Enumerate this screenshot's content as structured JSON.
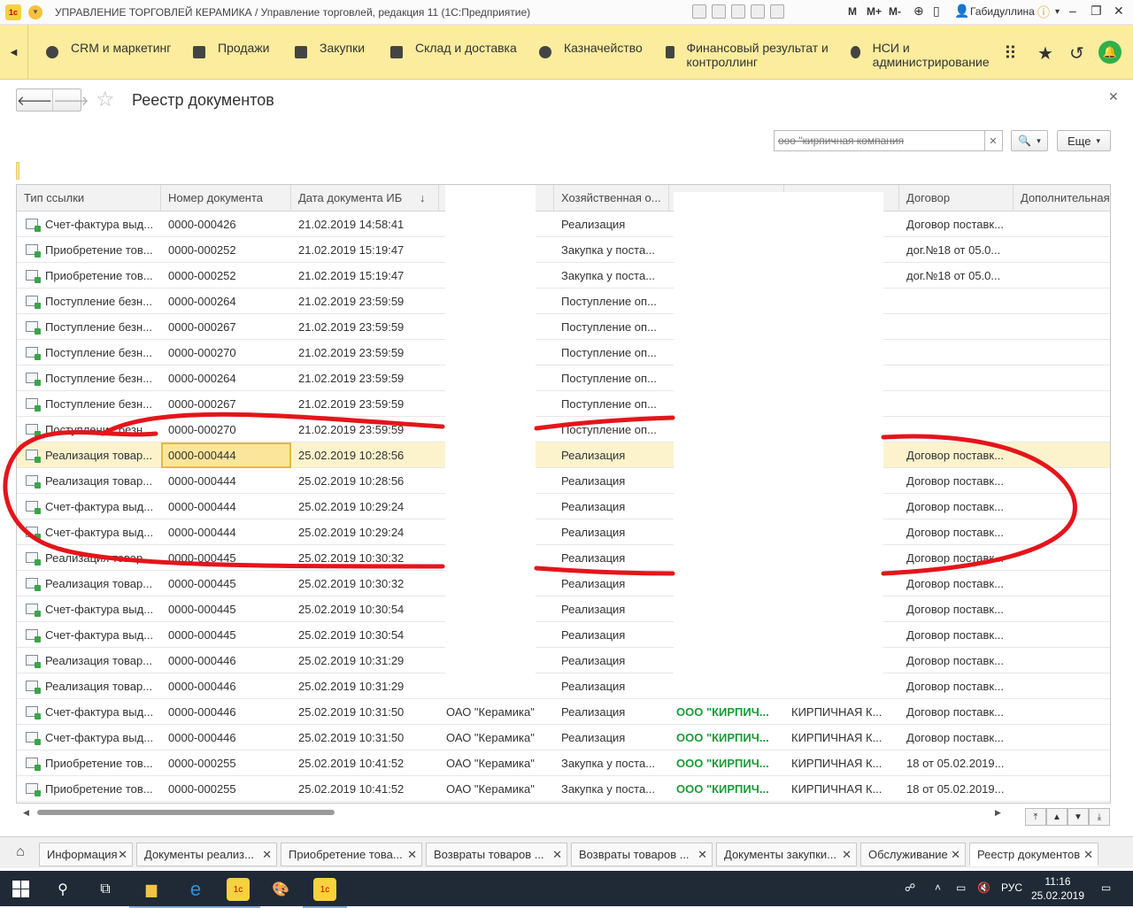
{
  "window": {
    "title": "УПРАВЛЕНИЕ ТОРГОВЛЕЙ КЕРАМИКА / Управление торговлей, редакция 11  (1С:Предприятие)",
    "m_labels": [
      "M",
      "M+",
      "M-"
    ],
    "user": "Габидуллина"
  },
  "menu": {
    "items": [
      {
        "label": "CRM и маркетинг",
        "icon": "pie-chart-icon"
      },
      {
        "label": "Продажи",
        "icon": "bag-icon"
      },
      {
        "label": "Закупки",
        "icon": "cart-icon"
      },
      {
        "label": "Склад и доставка",
        "icon": "warehouse-icon"
      },
      {
        "label": "Казначейство",
        "icon": "coin-icon"
      },
      {
        "label": "Финансовый результат и контроллинг",
        "icon": "bar-chart-icon"
      },
      {
        "label": "НСИ и администрирование",
        "icon": "gear-icon"
      }
    ]
  },
  "form": {
    "title": "Реестр документов",
    "search_value": "ооо \"кирпичная компания",
    "more_label": "Еще"
  },
  "table": {
    "columns": [
      "Тип ссылки",
      "Номер документа",
      "Дата документа ИБ",
      "",
      "Хозяйственная о...",
      "",
      "",
      "Договор",
      "Дополнительная"
    ],
    "sort_indicator": "↓",
    "rows": [
      {
        "type": "Счет-фактура выд...",
        "num": "0000-000426",
        "date": "21.02.2019 14:58:41",
        "org": "",
        "op": "Реализация",
        "partner": "",
        "counter": "",
        "contract": "Договор поставк..."
      },
      {
        "type": "Приобретение тов...",
        "num": "0000-000252",
        "date": "21.02.2019 15:19:47",
        "org": "",
        "op": "Закупка у поста...",
        "partner": "",
        "counter": "",
        "contract": "дог.№18 от 05.0..."
      },
      {
        "type": "Приобретение тов...",
        "num": "0000-000252",
        "date": "21.02.2019 15:19:47",
        "org": "",
        "op": "Закупка у поста...",
        "partner": "",
        "counter": "",
        "contract": "дог.№18 от 05.0..."
      },
      {
        "type": "Поступление безн...",
        "num": "0000-000264",
        "date": "21.02.2019 23:59:59",
        "org": "",
        "op": "Поступление оп...",
        "partner": "",
        "counter": "",
        "contract": ""
      },
      {
        "type": "Поступление безн...",
        "num": "0000-000267",
        "date": "21.02.2019 23:59:59",
        "org": "",
        "op": "Поступление оп...",
        "partner": "",
        "counter": "",
        "contract": ""
      },
      {
        "type": "Поступление безн...",
        "num": "0000-000270",
        "date": "21.02.2019 23:59:59",
        "org": "",
        "op": "Поступление оп...",
        "partner": "",
        "counter": "",
        "contract": ""
      },
      {
        "type": "Поступление безн...",
        "num": "0000-000264",
        "date": "21.02.2019 23:59:59",
        "org": "",
        "op": "Поступление оп...",
        "partner": "",
        "counter": "",
        "contract": ""
      },
      {
        "type": "Поступление безн...",
        "num": "0000-000267",
        "date": "21.02.2019 23:59:59",
        "org": "",
        "op": "Поступление оп...",
        "partner": "",
        "counter": "",
        "contract": ""
      },
      {
        "type": "Поступление безн...",
        "num": "0000-000270",
        "date": "21.02.2019 23:59:59",
        "org": "",
        "op": "Поступление оп...",
        "partner": "",
        "counter": "",
        "contract": ""
      },
      {
        "type": "Реализация товар...",
        "num": "0000-000444",
        "date": "25.02.2019 10:28:56",
        "org": "",
        "op": "Реализация",
        "partner": "",
        "counter": "",
        "contract": "Договор поставк..."
      },
      {
        "type": "Реализация товар...",
        "num": "0000-000444",
        "date": "25.02.2019 10:28:56",
        "org": "",
        "op": "Реализация",
        "partner": "",
        "counter": "",
        "contract": "Договор поставк..."
      },
      {
        "type": "Счет-фактура выд...",
        "num": "0000-000444",
        "date": "25.02.2019 10:29:24",
        "org": "",
        "op": "Реализация",
        "partner": "",
        "counter": "",
        "contract": "Договор поставк..."
      },
      {
        "type": "Счет-фактура выд...",
        "num": "0000-000444",
        "date": "25.02.2019 10:29:24",
        "org": "",
        "op": "Реализация",
        "partner": "",
        "counter": "",
        "contract": "Договор поставк..."
      },
      {
        "type": "Реализация товар...",
        "num": "0000-000445",
        "date": "25.02.2019 10:30:32",
        "org": "",
        "op": "Реализация",
        "partner": "",
        "counter": "",
        "contract": "Договор поставк..."
      },
      {
        "type": "Реализация товар...",
        "num": "0000-000445",
        "date": "25.02.2019 10:30:32",
        "org": "",
        "op": "Реализация",
        "partner": "",
        "counter": "",
        "contract": "Договор поставк..."
      },
      {
        "type": "Счет-фактура выд...",
        "num": "0000-000445",
        "date": "25.02.2019 10:30:54",
        "org": "",
        "op": "Реализация",
        "partner": "",
        "counter": "",
        "contract": "Договор поставк..."
      },
      {
        "type": "Счет-фактура выд...",
        "num": "0000-000445",
        "date": "25.02.2019 10:30:54",
        "org": "",
        "op": "Реализация",
        "partner": "",
        "counter": "",
        "contract": "Договор поставк..."
      },
      {
        "type": "Реализация товар...",
        "num": "0000-000446",
        "date": "25.02.2019 10:31:29",
        "org": "",
        "op": "Реализация",
        "partner": "",
        "counter": "",
        "contract": "Договор поставк..."
      },
      {
        "type": "Реализация товар...",
        "num": "0000-000446",
        "date": "25.02.2019 10:31:29",
        "org": "",
        "op": "Реализация",
        "partner": "",
        "counter": "",
        "contract": "Договор поставк..."
      },
      {
        "type": "Счет-фактура выд...",
        "num": "0000-000446",
        "date": "25.02.2019 10:31:50",
        "org": "ОАО \"Керамика\"",
        "op": "Реализация",
        "partner": "ООО \"КИРПИЧ...",
        "counter": "КИРПИЧНАЯ К...",
        "contract": "Договор поставк..."
      },
      {
        "type": "Счет-фактура выд...",
        "num": "0000-000446",
        "date": "25.02.2019 10:31:50",
        "org": "ОАО \"Керамика\"",
        "op": "Реализация",
        "partner": "ООО \"КИРПИЧ...",
        "counter": "КИРПИЧНАЯ К...",
        "contract": "Договор поставк..."
      },
      {
        "type": "Приобретение тов...",
        "num": "0000-000255",
        "date": "25.02.2019 10:41:52",
        "org": "ОАО \"Керамика\"",
        "op": "Закупка у поста...",
        "partner": "ООО \"КИРПИЧ...",
        "counter": "КИРПИЧНАЯ К...",
        "contract": "18 от 05.02.2019..."
      },
      {
        "type": "Приобретение тов...",
        "num": "0000-000255",
        "date": "25.02.2019 10:41:52",
        "org": "ОАО \"Керамика\"",
        "op": "Закупка у поста...",
        "partner": "ООО \"КИРПИЧ...",
        "counter": "КИРПИЧНАЯ К...",
        "contract": "18 от 05.02.2019..."
      }
    ],
    "selected_row": 9
  },
  "tabs": [
    {
      "label": "Информация"
    },
    {
      "label": "Документы реализ..."
    },
    {
      "label": "Приобретение това..."
    },
    {
      "label": "Возвраты товаров ..."
    },
    {
      "label": "Возвраты товаров ..."
    },
    {
      "label": "Документы закупки..."
    },
    {
      "label": "Обслуживание"
    },
    {
      "label": "Реестр документов",
      "active": true
    }
  ],
  "taskbar": {
    "lang": "РУС",
    "time": "11:16",
    "date": "25.02.2019"
  },
  "colors": {
    "menubar": "#fbec9e",
    "annotation": "#e5141b",
    "green_text": "#1c9a3a",
    "selection": "#fbe59a"
  }
}
